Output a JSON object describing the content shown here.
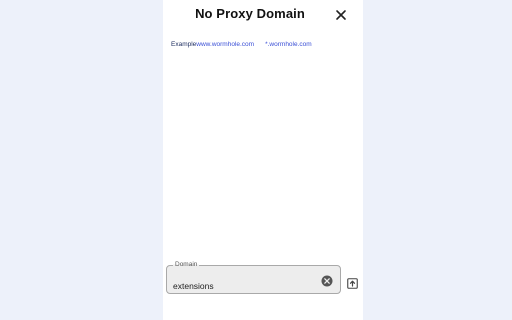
{
  "dialog": {
    "title": "No Proxy Domain",
    "close_icon": "close-icon"
  },
  "examples": {
    "label": "Example",
    "items": [
      "www.wormhole.com",
      "*.wormhole.com"
    ]
  },
  "domain_field": {
    "label": "Domain",
    "value": "extensions",
    "clear_icon": "clear-circle-icon"
  },
  "upload_icon": "upload-icon",
  "colors": {
    "page_background": "#edf1fa",
    "panel_background": "#ffffff",
    "example_link": "#3a4fd6",
    "field_background": "#ededed"
  }
}
